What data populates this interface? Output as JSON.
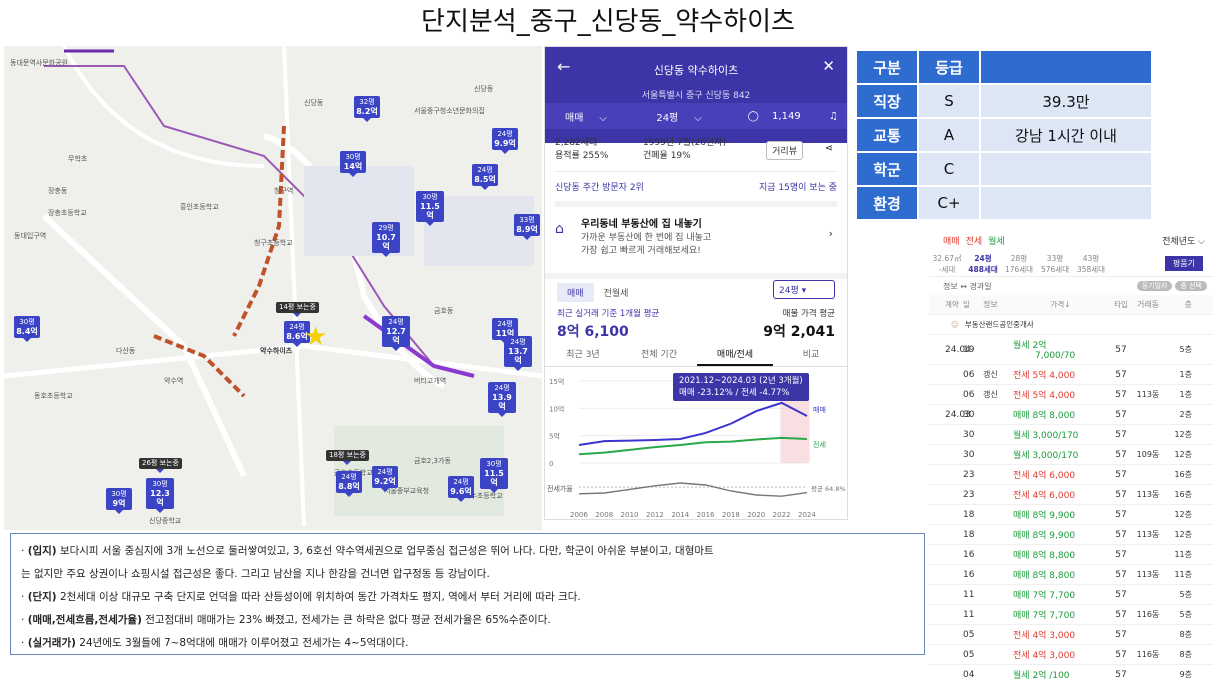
{
  "title": "단지분석_중구_신당동_약수하이츠",
  "map": {
    "labels": [
      "동대문역사문화공원",
      "신당동",
      "흥인초등학교",
      "무학초",
      "신당동",
      "장충동",
      "장충초등학교",
      "서울중구청소년문화의집",
      "동대입구역",
      "약수역",
      "버티고개역",
      "청구역",
      "청구초등학교",
      "다산동",
      "금호동",
      "금호2,3가동",
      "금호초등학교",
      "옥수초등학교",
      "신당중학교",
      "동호초등학교",
      "서울중부교육청",
      "약수하이츠"
    ],
    "pins": [
      {
        "size": "32평",
        "price": "8.2억"
      },
      {
        "size": "30평",
        "price": "14억"
      },
      {
        "size": "24평",
        "price": "9.9억"
      },
      {
        "size": "24평",
        "price": "8.5억"
      },
      {
        "size": "30평",
        "price": "11.5억"
      },
      {
        "size": "29평",
        "price": "10.7억"
      },
      {
        "size": "33평",
        "price": "8.9억"
      },
      {
        "size": "30평",
        "price": "8.4억"
      },
      {
        "size": "24평",
        "price": "8.6억"
      },
      {
        "size": "24평",
        "price": "12.7억"
      },
      {
        "size": "24평",
        "price": "11억"
      },
      {
        "size": "24평",
        "price": "13.7억"
      },
      {
        "size": "24평",
        "price": "13.9억"
      },
      {
        "size": "24평",
        "price": "8.8억"
      },
      {
        "size": "24평",
        "price": "9.2억"
      },
      {
        "size": "24평",
        "price": "9.6억"
      },
      {
        "size": "30평",
        "price": "11.5억"
      },
      {
        "size": "30평",
        "price": "12.3억"
      },
      {
        "size": "30평",
        "price": "9억"
      }
    ],
    "callouts": [
      "14평 보는중",
      "26평 보는중",
      "18평 보는중"
    ]
  },
  "app": {
    "title": "신당동 약수하이츠",
    "address": "서울특별시 중구 신당동 842",
    "tab_trade": "매매",
    "tab_size": "24평",
    "comments": "1,149",
    "households": "2,282세대",
    "floor_ratio": "용적률 255%",
    "built": "1999년 7월(26년차)",
    "coverage": "건폐율 19%",
    "review_btn": "거리뷰",
    "visitors": "신당동 주간 방문자 2위",
    "visitors_now": "지금 15명이 보는 중",
    "promo_title": "우리동네 부동산에 집 내놓기",
    "promo_sub1": "가까운 부동산에 한 번에 집 내놓고",
    "promo_sub2": "가장 쉽고 빠르게 거래해보세요!",
    "seg_trade": "매매",
    "seg_rent": "전월세",
    "seg_size": "24평",
    "avg_label": "최근 실거래 기준 1개월 평균",
    "avg_value": "8억 6,100",
    "ask_label": "매물 가격 평균",
    "ask_value": "9억 2,041",
    "chart_tabs": [
      "최근 3년",
      "전체 기간",
      "매매/전세",
      "비교"
    ],
    "tooltip_period": "2021.12~2024.03 (2년 3개월)",
    "tooltip_change": "매매 -23.12% / 전세 -4.77%"
  },
  "chart_data": {
    "type": "line",
    "x": [
      2006,
      2008,
      2010,
      2012,
      2014,
      2016,
      2018,
      2020,
      2022,
      2024
    ],
    "y_ticks": [
      "15억",
      "10억",
      "5억",
      "0"
    ],
    "series": [
      {
        "name": "매매",
        "values": [
          3.3,
          4.0,
          4.1,
          4.2,
          4.4,
          5.5,
          7.2,
          9.5,
          11.0,
          8.6
        ]
      },
      {
        "name": "전세",
        "values": [
          1.6,
          1.9,
          2.4,
          2.9,
          3.3,
          3.8,
          3.9,
          4.3,
          4.6,
          4.4
        ]
      },
      {
        "name": "전세가율",
        "values": [
          48,
          50,
          59,
          68,
          75,
          70,
          55,
          45,
          42,
          51
        ]
      }
    ],
    "bottom_label": "전세가율",
    "avg_label": "평균 64.8%"
  },
  "grade": {
    "headers": [
      "구분",
      "등급",
      ""
    ],
    "rows": [
      {
        "label": "직장",
        "grade": "S",
        "value": "39.3만"
      },
      {
        "label": "교통",
        "grade": "A",
        "value": "강남 1시간 이내"
      },
      {
        "label": "학군",
        "grade": "C",
        "value": ""
      },
      {
        "label": "환경",
        "grade": "C+",
        "value": ""
      }
    ]
  },
  "trades": {
    "tabs": [
      "매매",
      "전세",
      "월세"
    ],
    "year_sel": "전체년도",
    "sizes": [
      {
        "size": "32.67㎡",
        "hh": "-세대"
      },
      {
        "size": "24평",
        "hh": "488세대"
      },
      {
        "size": "28평",
        "hh": "176세대"
      },
      {
        "size": "33평",
        "hh": "576세대"
      },
      {
        "size": "43평",
        "hh": "358세대"
      }
    ],
    "pyeong_btn": "평품기",
    "info_label": "정보 ↔ 경과일",
    "chips": [
      "등기일자",
      "중 선택"
    ],
    "cols": [
      "계약",
      "일",
      "정보",
      "가격↓",
      "타입",
      "거래동",
      "층"
    ],
    "agent": "부동산랜드공인중개사",
    "rows": [
      {
        "date": "24.04",
        "day": "19",
        "tag": "",
        "kind": "월세",
        "price": "2억",
        "price2": "7,000/70",
        "type": "57",
        "dong": "",
        "floor": "5층"
      },
      {
        "date": "",
        "day": "06",
        "tag": "갱신",
        "kind": "전세",
        "price": "5억 4,000",
        "type": "57",
        "dong": "",
        "floor": "1층"
      },
      {
        "date": "",
        "day": "06",
        "tag": "갱신",
        "kind": "전세",
        "price": "5억 4,000",
        "type": "57",
        "dong": "113동",
        "floor": "1층"
      },
      {
        "date": "24.03",
        "day": "30",
        "tag": "",
        "kind": "매매",
        "price": "8억 8,000",
        "type": "57",
        "dong": "",
        "floor": "2층"
      },
      {
        "date": "",
        "day": "30",
        "tag": "",
        "kind": "월세",
        "price": "3,000/170",
        "type": "57",
        "dong": "",
        "floor": "12층"
      },
      {
        "date": "",
        "day": "30",
        "tag": "",
        "kind": "월세",
        "price": "3,000/170",
        "type": "57",
        "dong": "109동",
        "floor": "12층"
      },
      {
        "date": "",
        "day": "23",
        "tag": "",
        "kind": "전세",
        "price": "4억 6,000",
        "type": "57",
        "dong": "",
        "floor": "16층"
      },
      {
        "date": "",
        "day": "23",
        "tag": "",
        "kind": "전세",
        "price": "4억 6,000",
        "type": "57",
        "dong": "113동",
        "floor": "16층"
      },
      {
        "date": "",
        "day": "18",
        "tag": "",
        "kind": "매매",
        "price": "8억 9,900",
        "type": "57",
        "dong": "",
        "floor": "12층"
      },
      {
        "date": "",
        "day": "18",
        "tag": "",
        "kind": "매매",
        "price": "8억 9,900",
        "type": "57",
        "dong": "113동",
        "floor": "12층"
      },
      {
        "date": "",
        "day": "16",
        "tag": "",
        "kind": "매매",
        "price": "8억 8,800",
        "type": "57",
        "dong": "",
        "floor": "11층"
      },
      {
        "date": "",
        "day": "16",
        "tag": "",
        "kind": "매매",
        "price": "8억 8,800",
        "type": "57",
        "dong": "113동",
        "floor": "11층"
      },
      {
        "date": "",
        "day": "11",
        "tag": "",
        "kind": "매매",
        "price": "7억 7,700",
        "type": "57",
        "dong": "",
        "floor": "5층"
      },
      {
        "date": "",
        "day": "11",
        "tag": "",
        "kind": "매매",
        "price": "7억 7,700",
        "type": "57",
        "dong": "116동",
        "floor": "5층"
      },
      {
        "date": "",
        "day": "05",
        "tag": "",
        "kind": "전세",
        "price": "4억 3,000",
        "type": "57",
        "dong": "",
        "floor": "8층"
      },
      {
        "date": "",
        "day": "05",
        "tag": "",
        "kind": "전세",
        "price": "4억 3,000",
        "type": "57",
        "dong": "116동",
        "floor": "8층"
      },
      {
        "date": "",
        "day": "04",
        "tag": "",
        "kind": "월세",
        "price": "2억 /100",
        "type": "57",
        "dong": "",
        "floor": "9층"
      }
    ]
  },
  "notes": [
    {
      "head": "(입지)",
      "text": " 보다시피 서울 중심지에 3개 노선으로 둘러쌓여있고, 3, 6호선 약수역세권으로 업무중심 접근성은 뛰어 나다. 다만, 학군이 아쉬운 부분이고, 대형마트"
    },
    {
      "head": "",
      "text": "는 없지만 주요 상권이나 쇼핑시설 접근성은 좋다. 그리고 남산을 지나 한강을 건너면 압구정동 등 강남이다."
    },
    {
      "head": "(단지)",
      "text": " 2천세대 이상 대규모 구축 단지로 언덕을 따라 산등성이에 위치하여 동간 가격차도 평지, 역에서 부터 거리에 따라 크다."
    },
    {
      "head": "(매매,전세흐름,전세가율)",
      "text": "   전고점대비 매매가는 23% 빠졌고, 전세가는 큰 하락은 없다 평균 전세가율은 65%수준이다."
    },
    {
      "head": "(실거래가)",
      "text": " 24년에도 3월들에 7~8억대에 매매가 이루어졌고 전세가는 4~5억대이다."
    }
  ]
}
